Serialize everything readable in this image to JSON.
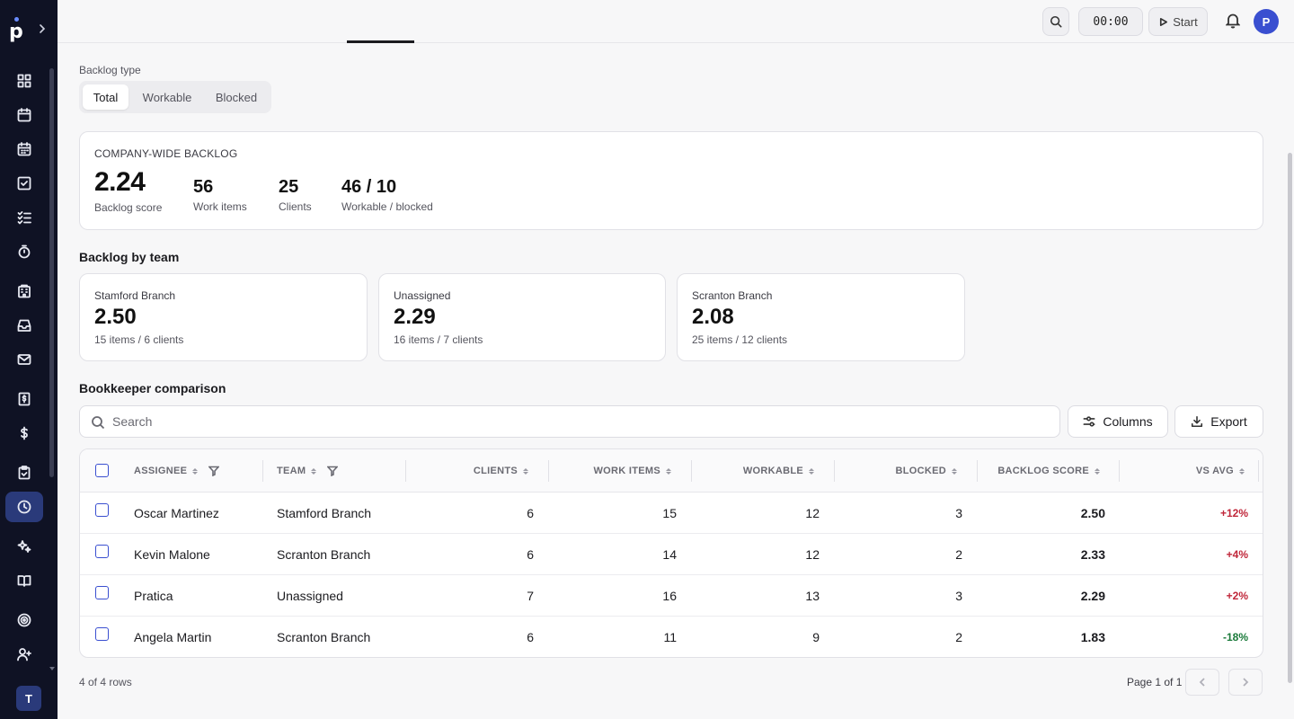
{
  "sidebar": {
    "logo_letter": "p",
    "team_avatar": "T",
    "icons": [
      "dashboard-icon",
      "calendar-icon",
      "calendar-grid-icon",
      "task-check-icon",
      "checklist-icon",
      "stopwatch-icon",
      "building-icon",
      "inbox-icon",
      "mail-icon",
      "invoice-icon",
      "dollar-icon",
      "clipboard-icon",
      "clock-icon",
      "sparkle-icon",
      "book-icon",
      "target-icon",
      "user-plus-icon"
    ],
    "active_index": 12
  },
  "topbar": {
    "timer": "00:00",
    "start_label": "Start",
    "user_initial": "P"
  },
  "backlog_type": {
    "label": "Backlog type",
    "options": [
      "Total",
      "Workable",
      "Blocked"
    ],
    "selected": "Total"
  },
  "company": {
    "title": "COMPANY-WIDE BACKLOG",
    "score": "2.24",
    "score_label": "Backlog score",
    "work_items": "56",
    "work_items_label": "Work items",
    "clients": "25",
    "clients_label": "Clients",
    "workable_blocked": "46 / 10",
    "workable_blocked_label": "Workable / blocked"
  },
  "by_team": {
    "title": "Backlog by team",
    "teams": [
      {
        "name": "Stamford Branch",
        "score": "2.50",
        "sub": "15 items / 6 clients"
      },
      {
        "name": "Unassigned",
        "score": "2.29",
        "sub": "16 items / 7 clients"
      },
      {
        "name": "Scranton Branch",
        "score": "2.08",
        "sub": "25 items / 12 clients"
      }
    ]
  },
  "comparison": {
    "title": "Bookkeeper comparison",
    "search_placeholder": "Search",
    "columns_label": "Columns",
    "export_label": "Export",
    "headers": {
      "assignee": "ASSIGNEE",
      "team": "TEAM",
      "clients": "CLIENTS",
      "work_items": "WORK ITEMS",
      "workable": "WORKABLE",
      "blocked": "BLOCKED",
      "backlog_score": "BACKLOG SCORE",
      "vs_avg": "VS AVG"
    },
    "rows": [
      {
        "assignee": "Oscar Martinez",
        "team": "Stamford Branch",
        "clients": "6",
        "work_items": "15",
        "workable": "12",
        "blocked": "3",
        "score": "2.50",
        "vs_avg": "+12%"
      },
      {
        "assignee": "Kevin Malone",
        "team": "Scranton Branch",
        "clients": "6",
        "work_items": "14",
        "workable": "12",
        "blocked": "2",
        "score": "2.33",
        "vs_avg": "+4%"
      },
      {
        "assignee": "Pratica",
        "team": "Unassigned",
        "clients": "7",
        "work_items": "16",
        "workable": "13",
        "blocked": "3",
        "score": "2.29",
        "vs_avg": "+2%"
      },
      {
        "assignee": "Angela Martin",
        "team": "Scranton Branch",
        "clients": "6",
        "work_items": "11",
        "workable": "9",
        "blocked": "2",
        "score": "1.83",
        "vs_avg": "-18%"
      }
    ],
    "row_count": "4 of 4 rows",
    "page_label": "Page 1 of 1"
  },
  "colors": {
    "sidebar_bg": "#0f1224",
    "accent": "#3a4fd0",
    "positive_delta": "#c0273a",
    "negative_delta": "#1a7a3a"
  }
}
